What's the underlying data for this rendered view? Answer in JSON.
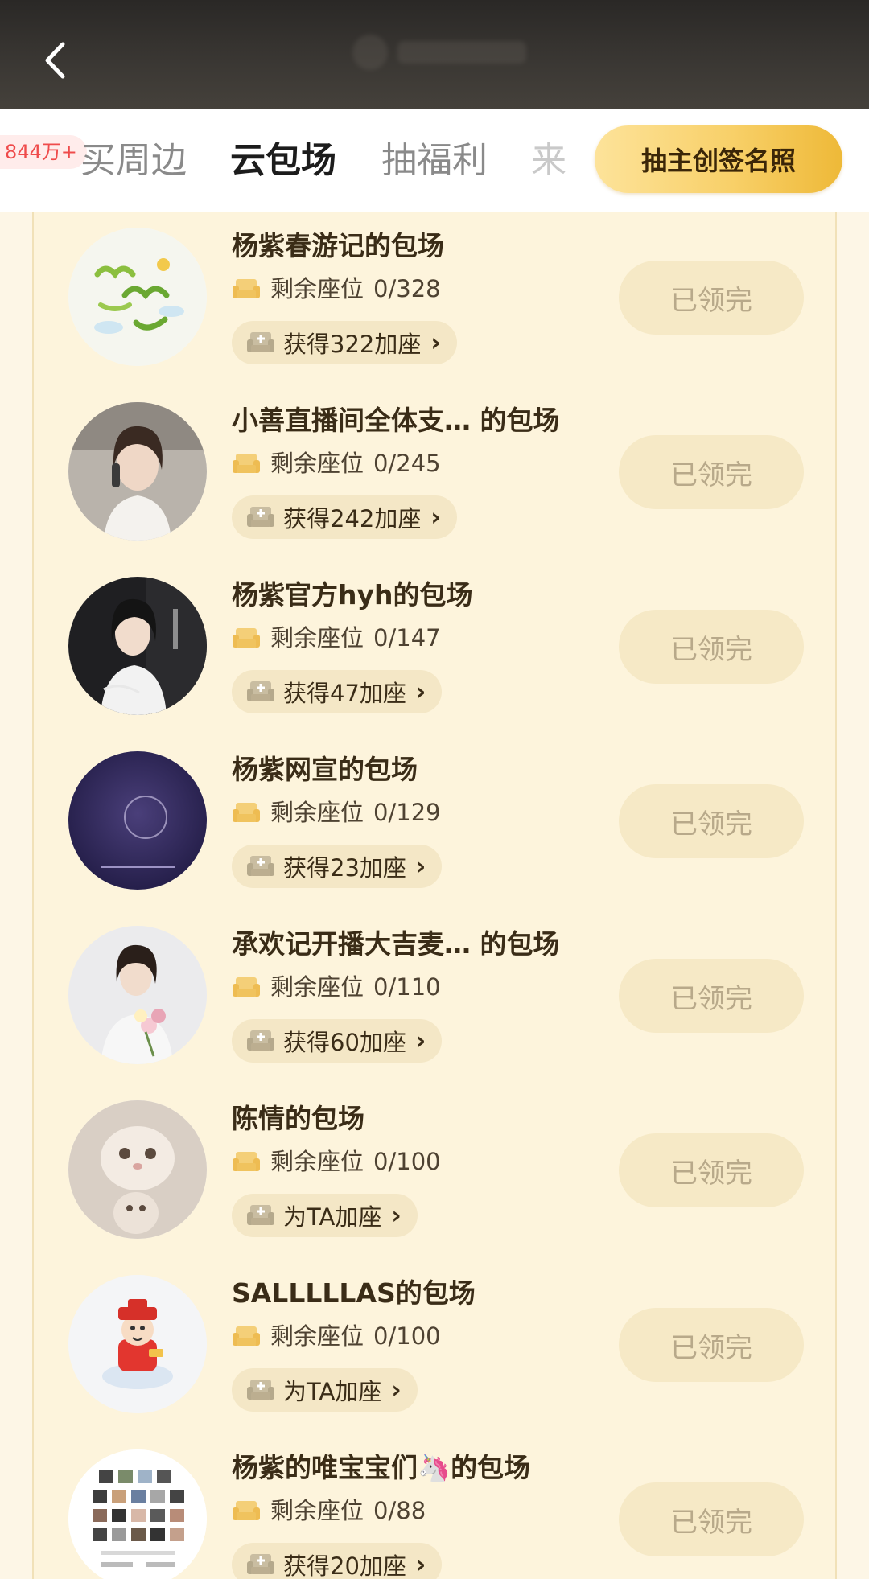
{
  "header": {
    "back_icon": "chevron-left-icon"
  },
  "tabs": {
    "badge": "844万+",
    "items": [
      {
        "label": "买周边",
        "active": false
      },
      {
        "label": "云包场",
        "active": true
      },
      {
        "label": "抽福利",
        "active": false
      },
      {
        "label": "来",
        "active": false
      }
    ],
    "lottery_button": "抽主创签名照"
  },
  "colors": {
    "accent": "#f8d069",
    "badge_red": "#ef4b4b",
    "panel_bg": "#fdf4dc"
  },
  "list": [
    {
      "title": "杨紫春游记的包场",
      "seats_label": "剩余座位",
      "seats": "0/328",
      "action": "获得322加座",
      "button": "已领完",
      "avatar": "spring-trip-logo"
    },
    {
      "title": "小善直播间全体支… 的包场",
      "seats_label": "剩余座位",
      "seats": "0/245",
      "action": "获得242加座",
      "button": "已领完",
      "avatar": "woman-phone-photo"
    },
    {
      "title": "杨紫官方hyh的包场",
      "seats_label": "剩余座位",
      "seats": "0/147",
      "action": "获得47加座",
      "button": "已领完",
      "avatar": "poster-photo"
    },
    {
      "title": "杨紫网宣的包场",
      "seats_label": "剩余座位",
      "seats": "0/129",
      "action": "获得23加座",
      "button": "已领完",
      "avatar": "moon-logo"
    },
    {
      "title": "承欢记开播大吉麦… 的包场",
      "seats_label": "剩余座位",
      "seats": "0/110",
      "action": "获得60加座",
      "button": "已领完",
      "avatar": "woman-flowers-photo"
    },
    {
      "title": "陈情的包场",
      "seats_label": "剩余座位",
      "seats": "0/100",
      "action": "为TA加座",
      "button": "已领完",
      "avatar": "cats-photo"
    },
    {
      "title": "SALLLLLAS的包场",
      "seats_label": "剩余座位",
      "seats": "0/100",
      "action": "为TA加座",
      "button": "已领完",
      "avatar": "fortune-god-cartoon"
    },
    {
      "title": "杨紫的唯宝宝们🦄的包场",
      "seats_label": "剩余座位",
      "seats": "0/88",
      "action": "获得20加座",
      "button": "已领完",
      "avatar": "grid-screenshot"
    }
  ]
}
